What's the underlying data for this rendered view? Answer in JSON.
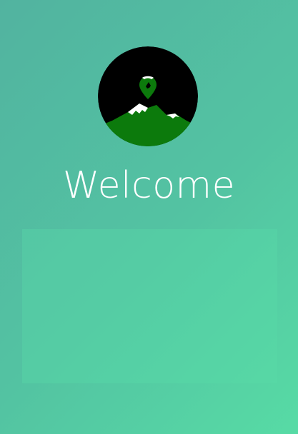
{
  "header": {
    "logo_icon": "mountain-location-pin-logo-icon",
    "welcome_text": "Welcome"
  },
  "colors": {
    "gradient_start": "#52b3a0",
    "gradient_end": "#57dba5",
    "logo_background": "#000000",
    "mountain_green": "#0c7a0c",
    "snow": "#ffffff",
    "text": "#ffffff"
  }
}
